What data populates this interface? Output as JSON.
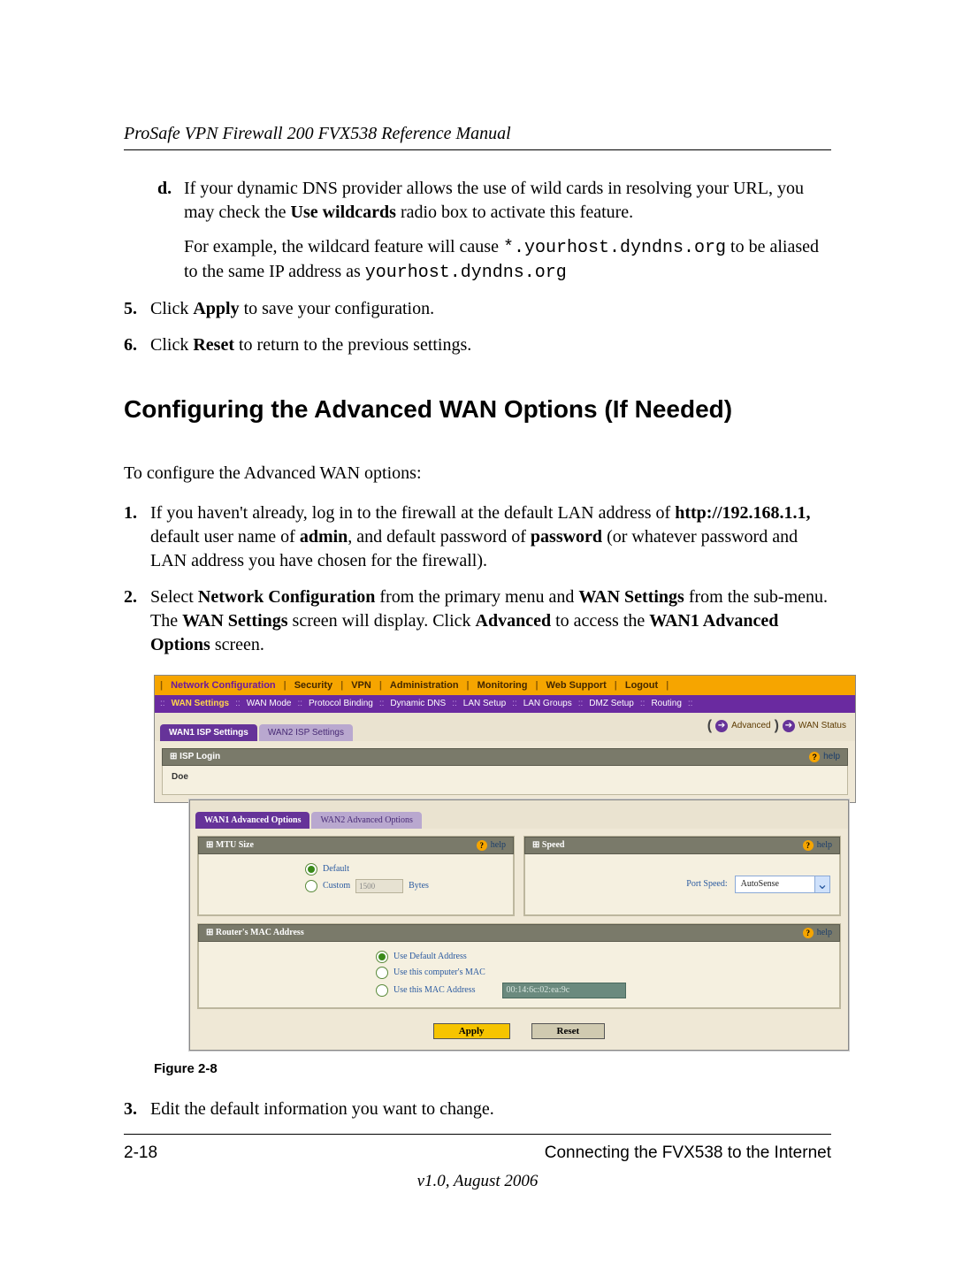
{
  "header": {
    "title": "ProSafe VPN Firewall 200 FVX538 Reference Manual"
  },
  "para_d_marker": "d.",
  "para_d_1a": "If your dynamic DNS provider allows the use of wild cards in resolving your URL, you may check the ",
  "para_d_1b": "Use wildcards",
  "para_d_1c": " radio box to activate this feature.",
  "para_d_2a": "For example, the wildcard feature will cause ",
  "para_d_2b": "*.yourhost.dyndns.org",
  "para_d_2c": " to be aliased to the same IP address as ",
  "para_d_2d": "yourhost.dyndns.org",
  "step5_marker": "5.",
  "step5a": "Click ",
  "step5b": "Apply",
  "step5c": " to save your configuration.",
  "step6_marker": "6.",
  "step6a": "Click ",
  "step6b": "Reset",
  "step6c": " to return to the previous settings.",
  "section_heading": "Configuring the Advanced WAN Options (If Needed)",
  "intro": "To configure the Advanced WAN options:",
  "s1_marker": "1.",
  "s1a": "If you haven't already, log in to the firewall at the default LAN address of ",
  "s1b": "http://192.168.1.1,",
  "s1c": " default user name of ",
  "s1d": "admin",
  "s1e": ", and default password of ",
  "s1f": "password",
  "s1g": " (or whatever password and LAN address you have chosen for the firewall).",
  "s2_marker": "2.",
  "s2a": "Select ",
  "s2b": "Network Configuration",
  "s2c": " from the primary menu and ",
  "s2d": "WAN Settings",
  "s2e": " from the sub-menu. The ",
  "s2f": "WAN Settings",
  "s2g": " screen will display. Click ",
  "s2h": "Advanced",
  "s2i": " to access the ",
  "s2j": "WAN1 Advanced Options",
  "s2k": " screen.",
  "figure_caption": "Figure 2-8",
  "s3_marker": "3.",
  "s3_text": "Edit the default information you want to change.",
  "footer": {
    "page": "2-18",
    "chapter": "Connecting the FVX538 to the Internet",
    "version": "v1.0, August 2006"
  },
  "ui": {
    "nav1": [
      "Network Configuration",
      "Security",
      "VPN",
      "Administration",
      "Monitoring",
      "Web Support",
      "Logout"
    ],
    "nav2": [
      "WAN Settings",
      "WAN Mode",
      "Protocol Binding",
      "Dynamic DNS",
      "LAN Setup",
      "LAN Groups",
      "DMZ Setup",
      "Routing"
    ],
    "tabs_outer": {
      "active": "WAN1 ISP Settings",
      "other": "WAN2 ISP Settings"
    },
    "links": {
      "advanced": "Advanced",
      "wan_status": "WAN Status"
    },
    "isp_login": {
      "title": "ISP Login",
      "does_label": "Doe",
      "help": "help"
    },
    "tabs_inner": {
      "active": "WAN1 Advanced Options",
      "other": "WAN2 Advanced Options"
    },
    "mtu": {
      "title": "MTU Size",
      "help": "help",
      "opt_default": "Default",
      "opt_custom": "Custom",
      "custom_val": "1500",
      "bytes": "Bytes"
    },
    "speed": {
      "title": "Speed",
      "help": "help",
      "label": "Port Speed:",
      "value": "AutoSense"
    },
    "mac": {
      "title": "Router's MAC Address",
      "help": "help",
      "opt1": "Use Default Address",
      "opt2": "Use this computer's MAC",
      "opt3": "Use this MAC Address",
      "val": "00:14:6c:02:ea:9c"
    },
    "buttons": {
      "apply": "Apply",
      "reset": "Reset"
    }
  }
}
